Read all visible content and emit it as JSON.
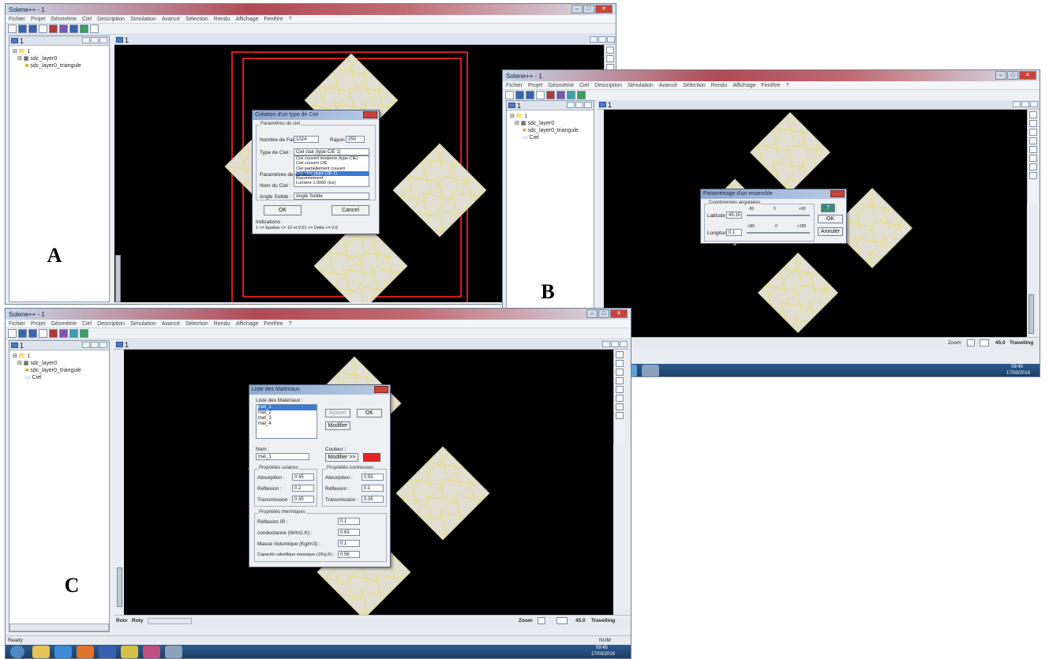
{
  "app_title": "Solene++ - 1",
  "app_title_b": "Solene++ - 1",
  "menu": [
    "Fichier",
    "Projet",
    "Géométrie",
    "Ciel",
    "Description",
    "Simulation",
    "Avancé",
    "Sélection",
    "Rendu",
    "Affichage",
    "Fenêtre",
    "?"
  ],
  "panelA": {
    "title": "1",
    "tree": [
      "1",
      "sdc_layer0",
      "sdc_layer0_triangule"
    ]
  },
  "panelB": {
    "title": "1",
    "tree": [
      "1",
      "sdc_layer0",
      "sdc_layer0_triangule",
      "Ciel"
    ]
  },
  "panelC": {
    "title": "1",
    "tree": [
      "1",
      "sdc_layer0",
      "sdc_layer0_triangule",
      "Ciel"
    ]
  },
  "viewport_title": "1",
  "dialogA": {
    "title": "Création d'un type de Ciel",
    "group_label": "Paramètres du ciel",
    "nb_faces_label": "Nombre de Faces :",
    "nb_faces_value": "1024",
    "rayon_label": "Rayon :",
    "rayon_value": "250",
    "type_label": "Type de Ciel :",
    "type_value": "Ciel clair (type CIE 1)",
    "options": [
      "Ciel couvert moderne (type CIE)",
      "Ciel couvert CIE",
      "Ciel partiellement couvert",
      "Ciel clair (type CIE 1)",
      "Rayonnement",
      "Lumière 1.0000 (lux)"
    ],
    "selected_option": 3,
    "param_label": "Paramètres de surface",
    "nom_label": "Nom du Ciel :",
    "angle_label": "Angle Solide :",
    "angle_value": "Angle Solide",
    "ok": "OK",
    "cancel": "Cancel",
    "hint_label": "Indications",
    "hint_text": "1 <= Epsilon <= 10   et   0.01 <= Delta <= 0.6"
  },
  "dialogB": {
    "title": "Paramétrage d'un ensemble",
    "group_label": "Coordonnées angulaires",
    "latitude_label": "Latitude",
    "latitude_value": "45.15",
    "longitude_label": "Longitude",
    "longitude_value": "0.1",
    "lat_ticks": [
      "-90",
      "0",
      "+90"
    ],
    "lon_ticks": [
      "-180",
      "0",
      "+180"
    ],
    "ok": "OK",
    "cancel": "Annuler",
    "help": "?"
  },
  "dialogC": {
    "title": "Liste des Matériaux",
    "list_label": "Liste des Matériaux :",
    "materials": [
      "mat_1",
      "mat_2",
      "mat_3",
      "mat_4"
    ],
    "selected": 0,
    "ajouter": "Ajouter",
    "ok": "OK",
    "modifier": "Modifier",
    "nom_label": "Nom :",
    "nom_value": "mat_1",
    "couleur_label": "Couleur :",
    "couleur_button": "Modifier >>",
    "couleur_value": "#e32424",
    "solar_group": "Propriétés solaires",
    "lum_group": "Propriétés lumineuses",
    "absorption_label": "Absorption :",
    "reflexion_label": "Réflexion :",
    "transmission_label": "Transmission :",
    "solar_absorption": "0.45",
    "solar_reflexion": "0.2",
    "solar_transmission": "0.35",
    "lum_absorption": "0.55",
    "lum_reflexion": "0.1",
    "lum_transmission": "0.35",
    "thermal_group": "Propriétés thermiques",
    "reflexion_ir_label": "Réflexion IR :",
    "reflexion_ir_value": "0.1",
    "conductance_label": "conductance (W/m2.K) :",
    "conductance_value": "0.63",
    "masse_label": "Masse Volumique (Kg/m3) :",
    "masse_value": "0.1",
    "capacite_label": "Capacité calorifique massique (J/Kg.K) :",
    "capacite_value": "0.56"
  },
  "bottom_controls": {
    "rotx_label": "Rotx",
    "roty_label": "Roty",
    "zoom_label": "Zoom",
    "zoom_value": "45.0",
    "travelling_label": "Travelling"
  },
  "status": {
    "ready": "Ready",
    "num": "NUM"
  },
  "clock": {
    "time": "09:45",
    "date": "17/03/2016"
  },
  "letters": {
    "a": "A",
    "b": "B",
    "c": "C"
  },
  "colors": {
    "viewport_bg": "#000000",
    "tile": "#e2ded3",
    "mesh": "#e6e07a",
    "sky_box": "#d11e1e"
  }
}
